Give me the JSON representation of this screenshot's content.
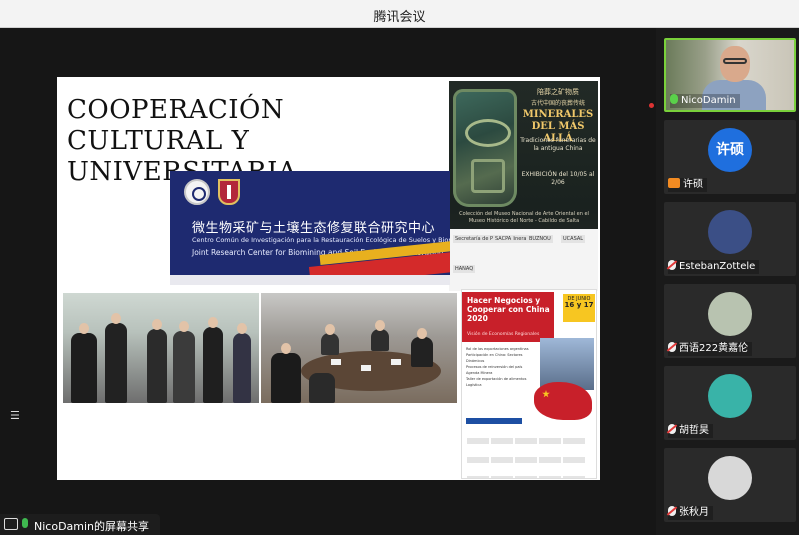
{
  "window": {
    "title": "腾讯会议"
  },
  "share_indicator": {
    "label": "NicoDamin的屏幕共享"
  },
  "slide": {
    "title": "COOPERACIÓN CULTURAL Y UNIVERSITARIA",
    "banner": {
      "zh": "微生物采矿与土壤生态修复联合研究中心",
      "es": "Centro Común de Investigación para la Restauración Ecológica de Suelos y Biominería",
      "en": "Joint Research Center for Biomining and Soil Ecological Restoration"
    },
    "poster_exhibition": {
      "zh_line1": "陪葬之矿物质",
      "zh_line2": "古代中国的丧葬传统",
      "title": "MINERALES DEL MÁS ALLÁ",
      "subtitle": "Tradiciones funerarias de la antigua China",
      "exhibition": "EXHIBICIÓN del 10/05 al 2/06",
      "collection": "Colección del Museo Nacional de Arte Oriental en el Museo Histórico del Norte - Cabildo de Salta",
      "logos": [
        "Secretaría de Política Minera",
        "SACPA",
        "BUZNOU",
        "UCASAL",
        "HANAQ"
      ]
    },
    "poster_business": {
      "title": "Hacer Negocios y Cooperar con China 2020",
      "subtitle": "Visión de Economías Regionales",
      "date_label": "DE JUNIO",
      "date": "16 y 17",
      "schedule_items": [
        "Rol de las exportaciones argentinas",
        "Participación en China: Sectores Dinámicos",
        "Procesos de reinversión del país",
        "Agenda Minera",
        "Taller de exportación de alimentos",
        "Logística"
      ]
    }
  },
  "participants": [
    {
      "name": "NicoDamin",
      "mic": "on",
      "type": "video",
      "active": true
    },
    {
      "name": "许硕",
      "mic": "user",
      "type": "initials",
      "initials": "许硕",
      "color": "#1f6fde"
    },
    {
      "name": "EstebanZottele",
      "mic": "off",
      "type": "avatar",
      "color": "#3b4f86"
    },
    {
      "name": "西语222黄嘉伦",
      "mic": "off",
      "type": "avatar",
      "color": "#b8c3b0"
    },
    {
      "name": "胡哲昊",
      "mic": "off",
      "type": "avatar",
      "color": "#39b3a8"
    },
    {
      "name": "张秋月",
      "mic": "off",
      "type": "avatar",
      "color": "#d8d8d8"
    }
  ],
  "colors": {
    "active_border": "#7ad13b",
    "mic_on": "#5ad04a",
    "mic_off_slash": "#e23b3b"
  }
}
